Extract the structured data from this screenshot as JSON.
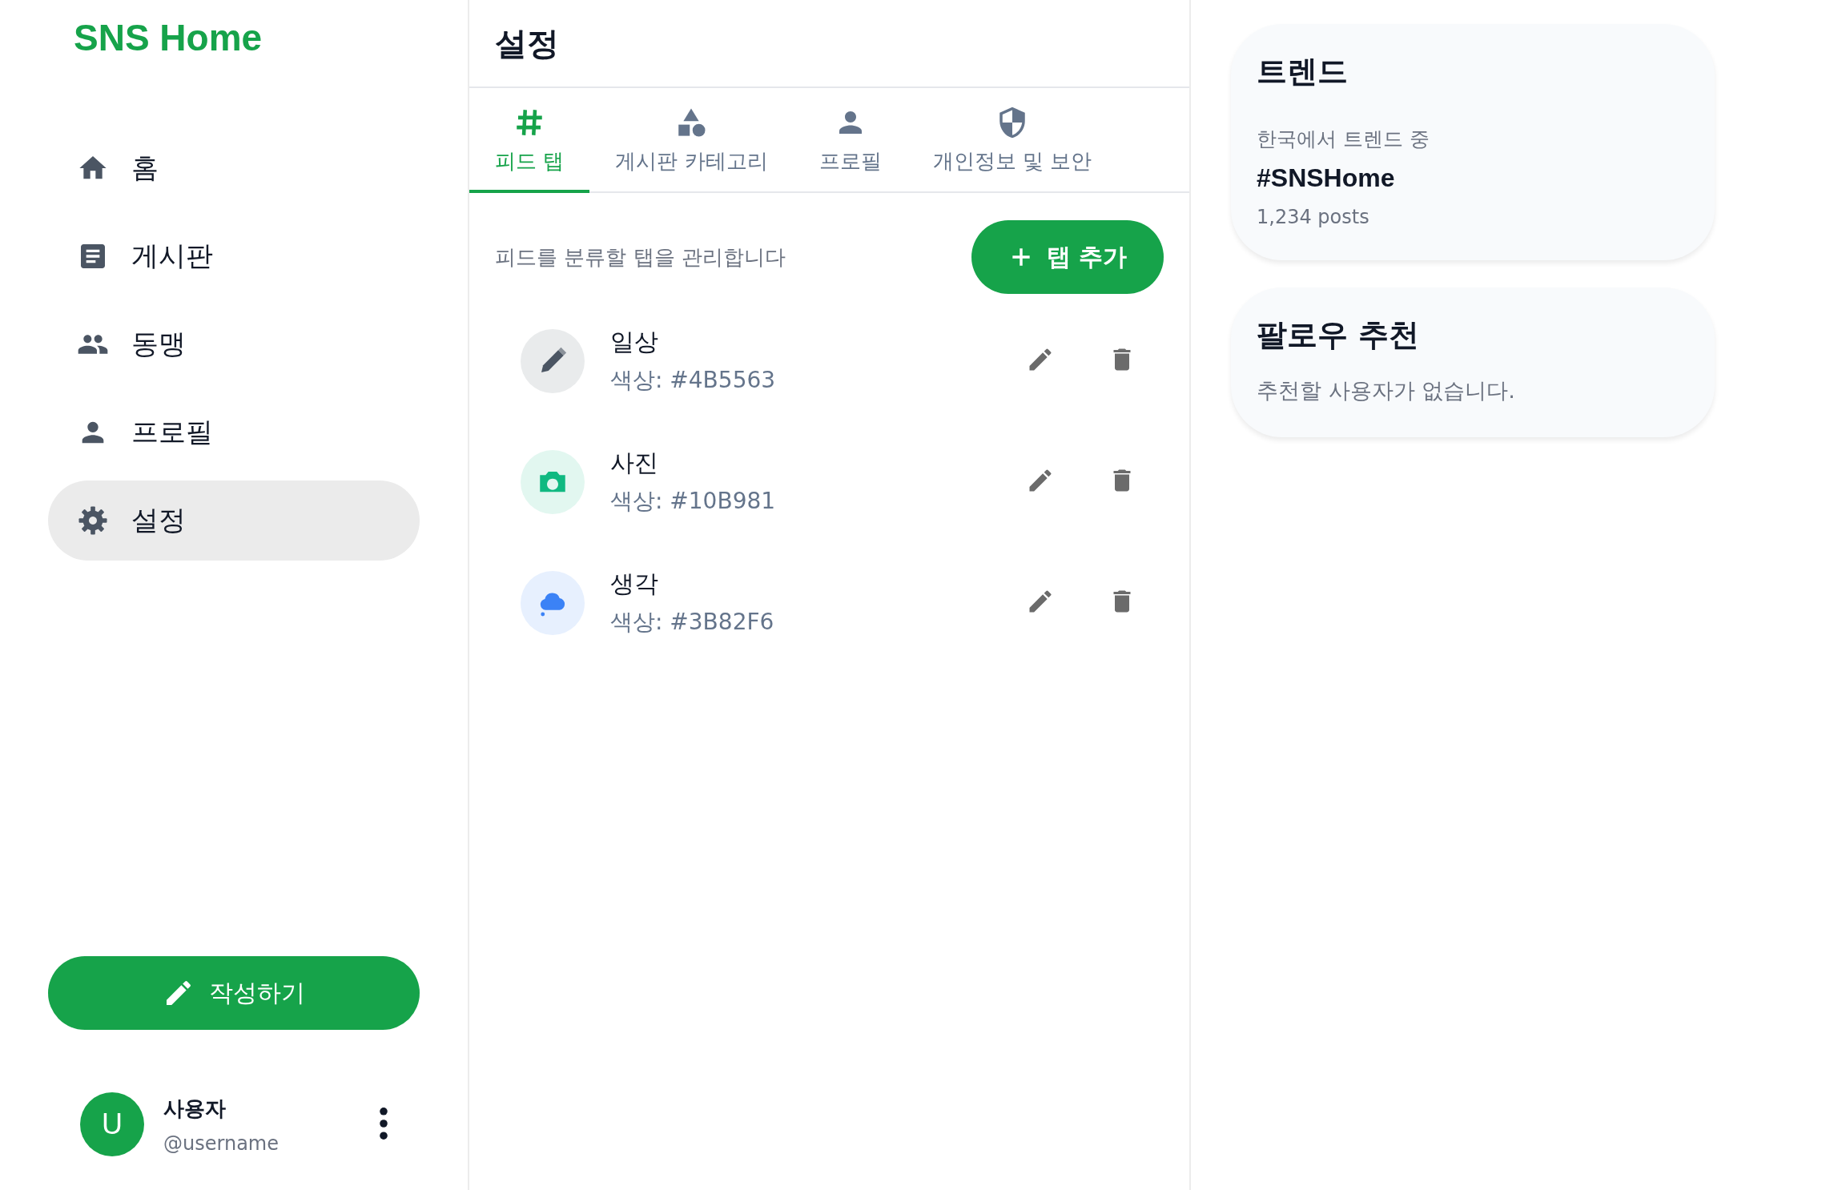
{
  "logo": "SNS Home",
  "sidebar": {
    "items": [
      {
        "label": "홈",
        "selected": false
      },
      {
        "label": "게시판",
        "selected": false
      },
      {
        "label": "동맹",
        "selected": false
      },
      {
        "label": "프로필",
        "selected": false
      },
      {
        "label": "설정",
        "selected": true
      }
    ],
    "compose_button": "작성하기",
    "user": {
      "avatar": "U",
      "name": "사용자",
      "handle": "@username"
    }
  },
  "settings": {
    "title": "설정",
    "tabs": [
      {
        "label": "피드 탭",
        "selected": true
      },
      {
        "label": "게시판 카테고리",
        "selected": false
      },
      {
        "label": "프로필",
        "selected": false
      },
      {
        "label": "개인정보 및 보안",
        "selected": false
      }
    ],
    "description": "피드를 분류할 탭을 관리합니다",
    "add_button": "탭 추가",
    "feed_tabs": [
      {
        "name": "일상",
        "color_text": "색상: #4B5563",
        "color": "#4b5563"
      },
      {
        "name": "사진",
        "color_text": "색상: #10B981",
        "color": "#10b981"
      },
      {
        "name": "생각",
        "color_text": "색상: #3B82F6",
        "color": "#3b82f6"
      }
    ]
  },
  "trends": {
    "title": "트렌드",
    "subtitle": "한국에서 트렌드 중",
    "tag": "#SNSHome",
    "count": "1,234 posts"
  },
  "follow": {
    "title": "팔로우 추천",
    "empty": "추천할 사용자가 없습니다."
  }
}
